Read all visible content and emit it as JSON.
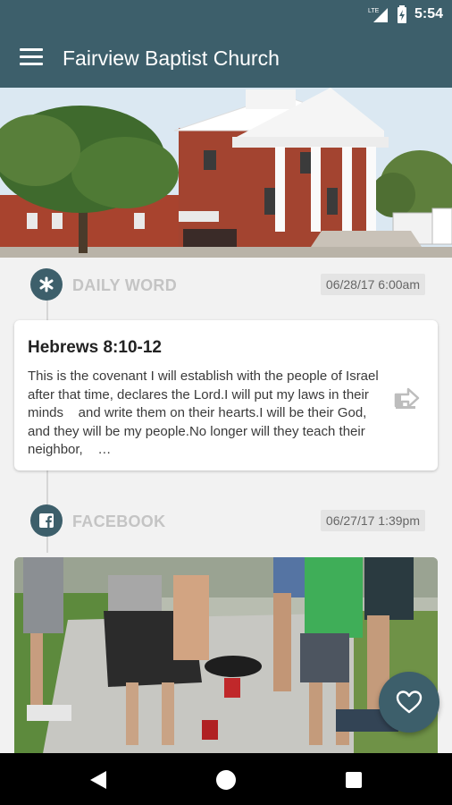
{
  "status_bar": {
    "network": "LTE",
    "time": "5:54"
  },
  "app_bar": {
    "title": "Fairview Baptist Church"
  },
  "hero": {
    "alt": "Church building photo"
  },
  "daily_word": {
    "section_label": "DAILY WORD",
    "date": "06/28/17 6:00am",
    "title": "Hebrews 8:10-12",
    "body": "This is the covenant I will establish with the people of Israel    after that time, declares the Lord.I will put my laws in their minds    and write them on their hearts.I will be their God,    and they will be my people.No longer will they teach their neighbor,    …"
  },
  "facebook": {
    "section_label": "FACEBOOK",
    "date": "06/27/17 1:39pm"
  },
  "colors": {
    "primary": "#3d5f6b",
    "background": "#f2f2f2",
    "label": "#c4c4c4"
  },
  "icons": {
    "menu": "hamburger-icon",
    "daily_word": "asterisk-icon",
    "facebook": "facebook-icon",
    "share": "share-icon",
    "favorite": "heart-icon"
  }
}
